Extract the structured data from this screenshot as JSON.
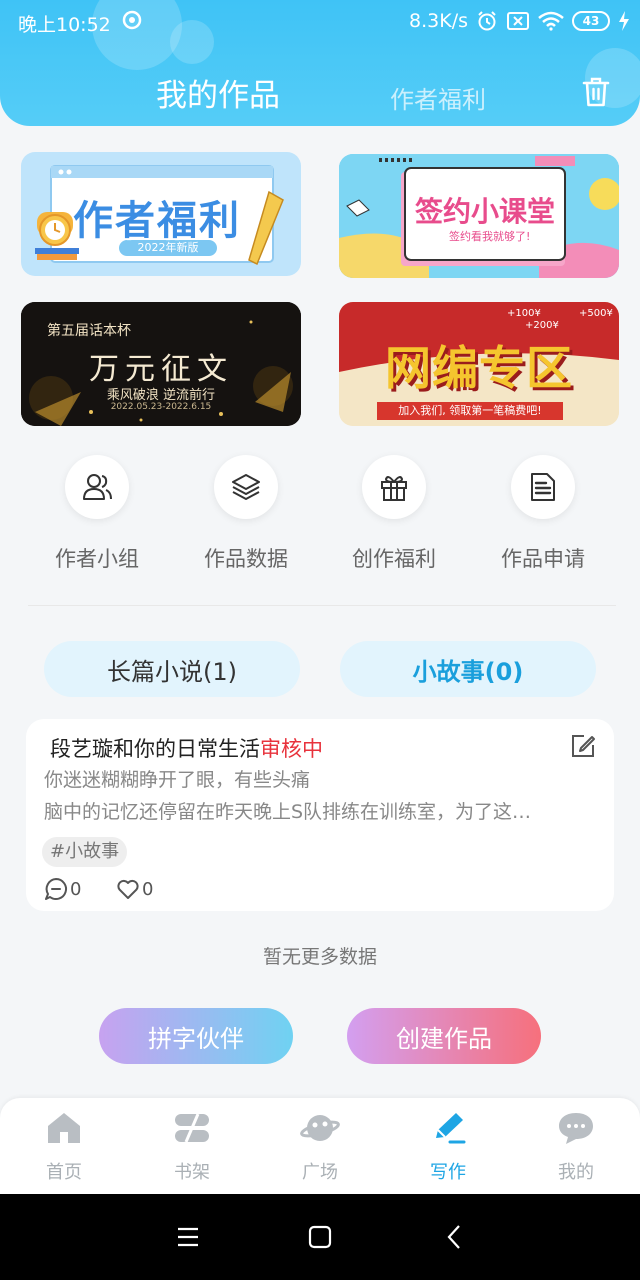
{
  "status_bar": {
    "time": "晚上10:52",
    "net_speed": "8.3K/s",
    "battery": "43"
  },
  "header": {
    "title_active": "我的作品",
    "title_inactive": "作者福利",
    "trash_icon": "trash-icon"
  },
  "banners": [
    {
      "title": "作者福利",
      "subtitle": "2022年新版"
    },
    {
      "title": "签约小课堂",
      "subtitle": "签约看我就够了!"
    },
    {
      "title": "万元征文",
      "subtitle": "第五届话本杯",
      "tagline": "乘风破浪 逆流前行",
      "dates": "2022.05.23-2022.6.15"
    },
    {
      "title": "网编专区",
      "subtitle": "加入我们, 领取第一笔稿费吧!",
      "prices": [
        "+100¥",
        "+500¥",
        "+200¥"
      ]
    }
  ],
  "entries": [
    {
      "label": "作者小组",
      "icon": "users-icon"
    },
    {
      "label": "作品数据",
      "icon": "layers-icon"
    },
    {
      "label": "创作福利",
      "icon": "gift-icon"
    },
    {
      "label": "作品申请",
      "icon": "document-icon"
    }
  ],
  "tabs": {
    "novel": "长篇小说(1)",
    "story": "小故事(0)"
  },
  "work_card": {
    "title": "段艺璇和你的日常生活",
    "status": "审核中",
    "line1": "你迷迷糊糊睁开了眼，有些头痛",
    "line2": "脑中的记忆还停留在昨天晚上S队排练在训练室，为了这…",
    "tag": "#小故事",
    "comments": "0",
    "likes": "0"
  },
  "no_more": "暂无更多数据",
  "buttons": {
    "partner": "拼字伙伴",
    "create": "创建作品"
  },
  "bottom_nav": [
    {
      "label": "首页",
      "icon": "home-icon"
    },
    {
      "label": "书架",
      "icon": "bookshelf-icon"
    },
    {
      "label": "广场",
      "icon": "planet-icon"
    },
    {
      "label": "写作",
      "icon": "pen-icon"
    },
    {
      "label": "我的",
      "icon": "chat-bubble-icon"
    }
  ],
  "colors": {
    "header": "#3fc3f6",
    "accent": "#1ea5e4",
    "status_red": "#e8323c"
  }
}
